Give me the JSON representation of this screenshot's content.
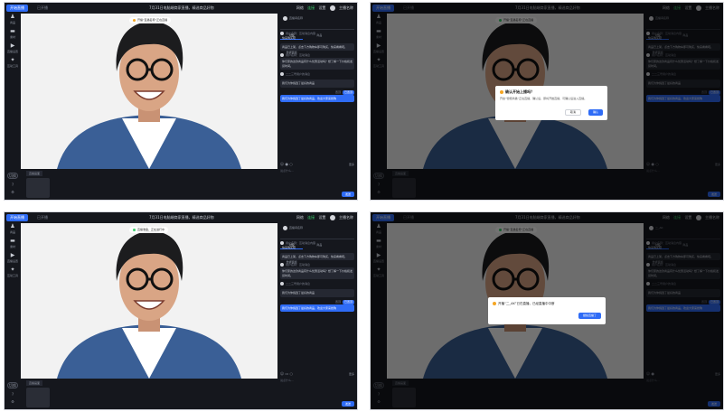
{
  "panels": [
    {
      "go_live": "开始直播",
      "subtitle": "已开播",
      "title": "7月31日电脑端商家直播，精选商品好物",
      "status_right": [
        "网络",
        "连接",
        "设置",
        "主播名称"
      ],
      "tip": "开播“直播名称”正在直播",
      "tip_dot_color": "#f5a623",
      "rail": [
        {
          "icon": "person-icon",
          "glyph": "♟",
          "label": "商品"
        },
        {
          "icon": "folder-icon",
          "glyph": "▬",
          "label": "素材"
        },
        {
          "icon": "video-icon",
          "glyph": "▶",
          "label": "直播设置"
        },
        {
          "icon": "gift-icon",
          "glyph": "✦",
          "label": "互动工具"
        }
      ],
      "rail_bottom": [
        "切换",
        "?",
        "⚙"
      ],
      "tray_tab": "直播画面",
      "side_header": "直播间名称",
      "side_tabs": [
        "讨论",
        "商品",
        "数据面板"
      ],
      "messages": [
        {
          "user": "用户名称：互动消息内容",
          "text": "快来购买吧",
          "sel": false
        },
        {
          "user": "",
          "text": "商品已上架，点击下方购物车即可购买，快来看看吧。",
          "sel": false
        },
        {
          "user": "用户名称：互动消息",
          "text": "你们家的这款商品有什么优惠活动吗？想了解一下价格和发货时间。",
          "sel": false
        },
        {
          "user": "二二三号用户的消息",
          "text": "",
          "sel": false
        },
        {
          "user": "",
          "text": "我们为你挑选了最好的商品",
          "sel": false
        },
        {
          "user": "",
          "text": "我们为你挑选了最好的商品，欢迎大家来抢购",
          "sel": true
        }
      ],
      "tag_line": "置顶",
      "tag_chip": "已置顶",
      "tools_right": "更多",
      "input_placeholder": "说点什么...",
      "send": "发送"
    },
    {
      "go_live": "开始直播",
      "subtitle": "已开播",
      "title": "7月31日电脑端商家直播，精选商品好物",
      "status_right": [
        "网络",
        "连接",
        "设置",
        "主播名称"
      ],
      "tip": "开播“直播名称”正在直播",
      "tip_dot_color": "#3ecf6e",
      "rail": [
        {
          "icon": "person-icon",
          "glyph": "♟",
          "label": "商品"
        },
        {
          "icon": "folder-icon",
          "glyph": "▬",
          "label": "素材"
        },
        {
          "icon": "video-icon",
          "glyph": "▶",
          "label": "直播设置"
        },
        {
          "icon": "gift-icon",
          "glyph": "✦",
          "label": "互动工具"
        }
      ],
      "rail_bottom": [
        "切换",
        "?",
        "⚙"
      ],
      "tray_tab": "直播画面",
      "side_header": "直播间名称",
      "side_tabs": [
        "讨论",
        "商品",
        "数据面板"
      ],
      "messages": [
        {
          "user": "用户名称：互动消息内容",
          "text": "快来购买吧",
          "sel": false
        },
        {
          "user": "",
          "text": "商品已上架，点击下方购物车即可购买，快来看看吧。",
          "sel": false
        },
        {
          "user": "用户名称：互动消息",
          "text": "你们家的这款商品有什么优惠活动吗？想了解一下价格和发货时间。",
          "sel": false
        },
        {
          "user": "二二三号用户的消息",
          "text": "",
          "sel": false
        },
        {
          "user": "",
          "text": "我们为你挑选了最好的商品",
          "sel": false
        },
        {
          "user": "",
          "text": "我们为你挑选了最好的商品，欢迎大家来抢购",
          "sel": true
        }
      ],
      "tag_line": "置顶",
      "tag_chip": "已置顶",
      "tools_right": "更多",
      "input_placeholder": "说点什么...",
      "send": "发送",
      "dialog": {
        "title": "确认开始上播吗？",
        "body": "开启“智能商播”正在直播，确认后，即将开始直播，可确认后进入直播。",
        "cancel": "取消",
        "ok": "确认"
      }
    },
    {
      "go_live": "开始直播",
      "subtitle": "已开播",
      "title": "7月31日电脑端商家直播，精选商品好物",
      "status_right": [
        "网络",
        "连接",
        "设置",
        "主播名称"
      ],
      "tip": "直播准备，正在进行中",
      "tip_dot_color": "#3ecf6e",
      "rail": [
        {
          "icon": "person-icon",
          "glyph": "♟",
          "label": "商品"
        },
        {
          "icon": "folder-icon",
          "glyph": "▬",
          "label": "素材"
        },
        {
          "icon": "video-icon",
          "glyph": "▶",
          "label": "直播设置"
        },
        {
          "icon": "gift-icon",
          "glyph": "✦",
          "label": "互动工具"
        }
      ],
      "rail_bottom": [
        "切换",
        "?",
        "⚙"
      ],
      "tray_tab": "直播画面",
      "side_header": "直播间名称",
      "side_tabs": [
        "讨论",
        "商品",
        "数据面板"
      ],
      "messages": [
        {
          "user": "用户名称：互动消息内容",
          "text": "快来购买吧",
          "sel": false
        },
        {
          "user": "",
          "text": "商品已上架，点击下方购物车即可购买，快来看看吧。",
          "sel": false
        },
        {
          "user": "用户名称：互动消息",
          "text": "你们家的这款商品有什么优惠活动吗？想了解一下价格和发货时间。",
          "sel": false
        },
        {
          "user": "二二三号用户的消息",
          "text": "",
          "sel": false
        },
        {
          "user": "",
          "text": "我们为你挑选了最好的商品",
          "sel": false
        },
        {
          "user": "",
          "text": "我们为你挑选了最好的商品，欢迎大家来抢购",
          "sel": true
        }
      ],
      "tag_line": "置顶",
      "tag_chip": "已置顶",
      "tools_right": "更多",
      "input_placeholder": "说点什么...",
      "send": "发送"
    },
    {
      "go_live": "开始直播",
      "subtitle": "已开播",
      "title": "7月31日电脑端商家直播，精选商品好物",
      "status_right": [
        "网络",
        "连接",
        "设置",
        "主播名称"
      ],
      "tip": "开播“直播名称”正在直播",
      "tip_dot_color": "#3ecf6e",
      "rail": [
        {
          "icon": "person-icon",
          "glyph": "♟",
          "label": "商品"
        },
        {
          "icon": "folder-icon",
          "glyph": "▬",
          "label": "素材"
        },
        {
          "icon": "video-icon",
          "glyph": "▶",
          "label": "直播设置"
        },
        {
          "icon": "gift-icon",
          "glyph": "✦",
          "label": "互动工具"
        }
      ],
      "rail_bottom": [
        "切换",
        "?",
        "⚙"
      ],
      "tray_tab": "直播画面",
      "side_header": "二_AK",
      "side_tabs": [
        "讨论",
        "商品",
        "数据面板"
      ],
      "messages": [
        {
          "user": "用户名称：互动消息内容",
          "text": "快来购买吧",
          "sel": false
        },
        {
          "user": "",
          "text": "商品已上架，点击下方购物车即可购买，快来看看吧。",
          "sel": false
        },
        {
          "user": "用户名称：互动消息",
          "text": "你们家的这款商品有什么优惠活动吗？想了解一下价格和发货时间。",
          "sel": false
        },
        {
          "user": "二二三号用户的消息",
          "text": "",
          "sel": false
        },
        {
          "user": "",
          "text": "我们为你挑选了最好的商品",
          "sel": false
        },
        {
          "user": "",
          "text": "我们为你挑选了最好的商品，欢迎大家来抢购",
          "sel": true
        }
      ],
      "tag_line": "置顶",
      "tag_chip": "已置顶",
      "tools_right": "更多",
      "input_placeholder": "说点什么...",
      "send": "发送",
      "dialog": {
        "title": "开播“二_AK”已在直播，已经直播中中断",
        "ok": "继续直播了"
      }
    }
  ]
}
